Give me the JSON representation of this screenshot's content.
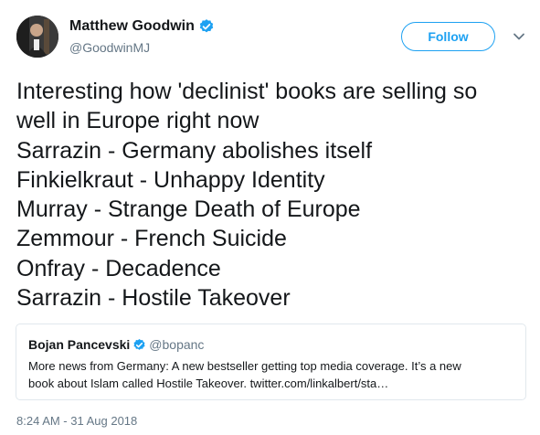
{
  "author": {
    "name": "Matthew Goodwin",
    "handle": "@GoodwinMJ",
    "verified": true
  },
  "actions": {
    "follow_label": "Follow"
  },
  "tweet": {
    "lines": [
      "Interesting how 'declinist' books are selling so",
      "well in Europe right now",
      "Sarrazin - Germany abolishes itself",
      "Finkielkraut - Unhappy Identity",
      "Murray - Strange Death of Europe",
      "Zemmour - French Suicide",
      "Onfray - Decadence",
      "Sarrazin - Hostile Takeover"
    ]
  },
  "quoted_tweet": {
    "name": "Bojan Pancevski",
    "handle": "@bopanc",
    "verified": true,
    "lines": [
      "More news from Germany: A new bestseller getting top media coverage. It’s a new",
      "book about Islam called Hostile Takeover. twitter.com/linkalbert/sta…"
    ]
  },
  "timestamp": "8:24 AM - 31 Aug 2018",
  "colors": {
    "accent": "#1da1f2",
    "text": "#14171a",
    "secondary": "#657786",
    "border": "#e1e8ed"
  },
  "icons": {
    "verified": "verified-badge-icon",
    "menu": "chevron-down-icon"
  }
}
